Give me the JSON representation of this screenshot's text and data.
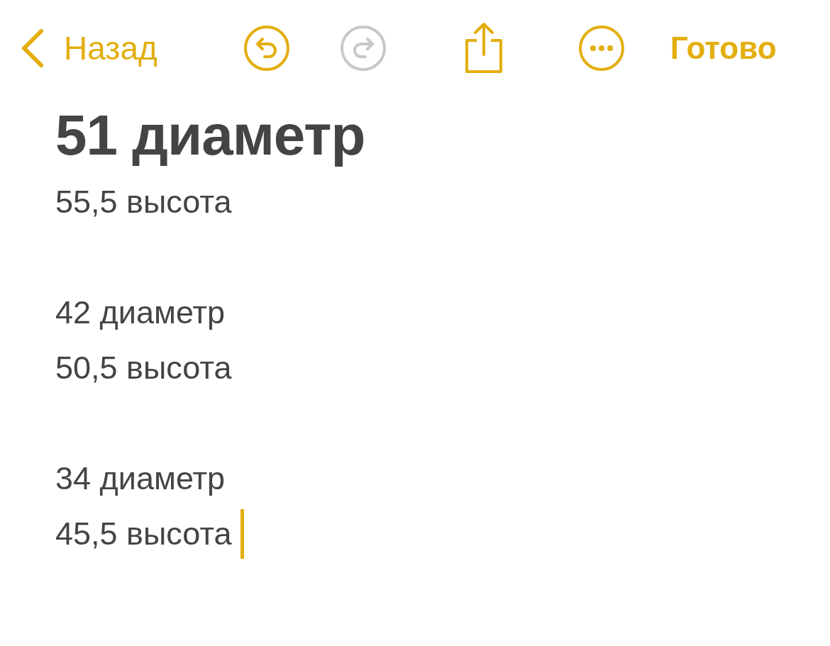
{
  "toolbar": {
    "back": {
      "label": "Назад"
    },
    "undo": {
      "disabled": false
    },
    "redo": {
      "disabled": true
    },
    "done": {
      "label": "Готово"
    }
  },
  "note": {
    "title": "51 диаметр",
    "blocks": [
      {
        "lines": [
          "55,5 высота"
        ]
      },
      {
        "lines": [
          "42 диаметр",
          "50,5 высота"
        ]
      },
      {
        "lines": [
          "34 диаметр",
          "45,5 высота"
        ]
      }
    ],
    "cursor": true
  }
}
